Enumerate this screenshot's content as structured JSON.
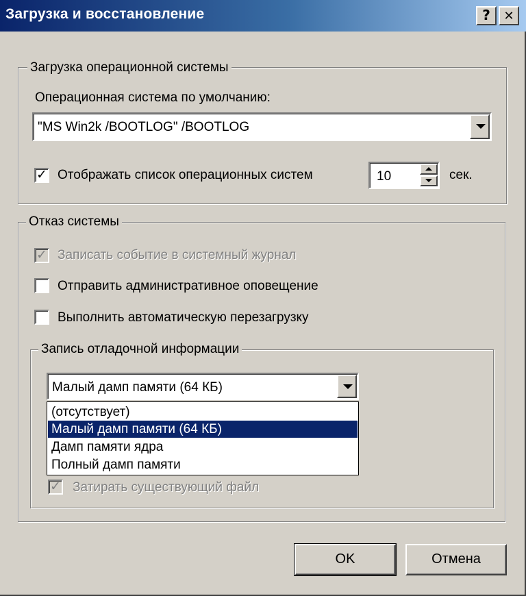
{
  "window": {
    "title": "Загрузка и восстановление",
    "help_button": "?",
    "close_button": "✕"
  },
  "startup_group": {
    "legend": "Загрузка операционной системы",
    "default_os_label": "Операционная система по умолчанию:",
    "default_os_value": "\"MS Win2k /BOOTLOG\" /BOOTLOG",
    "show_list_checked": true,
    "show_list_label": "Отображать список операционных систем",
    "timeout_value": "10",
    "timeout_unit": "сек."
  },
  "failure_group": {
    "legend": "Отказ системы",
    "write_event_label": "Записать событие в системный журнал",
    "write_event_checked": true,
    "send_alert_label": "Отправить административное оповещение",
    "send_alert_checked": false,
    "auto_restart_label": "Выполнить автоматическую перезагрузку",
    "auto_restart_checked": false
  },
  "debug_group": {
    "legend": "Запись отладочной информации",
    "dump_type_value": "Малый дамп памяти (64 КБ)",
    "dump_options": [
      {
        "label": "(отсутствует)",
        "selected": false
      },
      {
        "label": "Малый дамп памяти (64 КБ)",
        "selected": true
      },
      {
        "label": "Дамп памяти ядра",
        "selected": false
      },
      {
        "label": "Полный дамп памяти",
        "selected": false
      }
    ],
    "overwrite_label": "Затирать существующий файл",
    "overwrite_checked": true
  },
  "buttons": {
    "ok": "OK",
    "cancel": "Отмена"
  },
  "colors": {
    "title_gradient_start": "#0a246a",
    "title_gradient_end": "#a6caf0",
    "dialog_face": "#d4d0c8",
    "selection": "#0a246a"
  }
}
